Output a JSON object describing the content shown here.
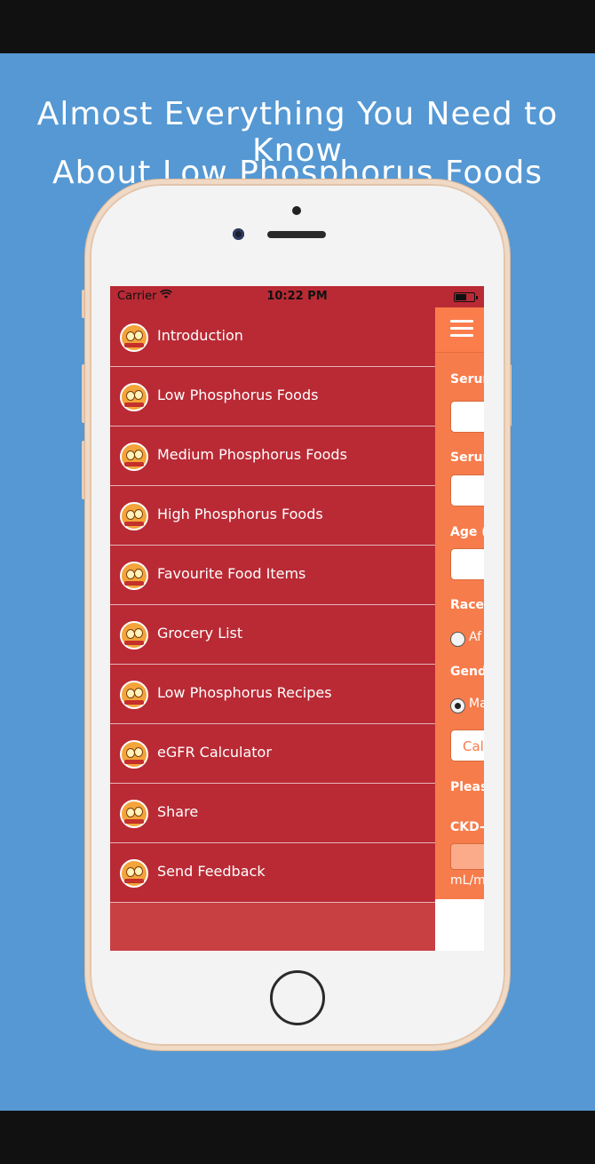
{
  "headline": {
    "line1": "Almost Everything You Need to Know",
    "line2": "About Low Phosphorus Foods"
  },
  "status_bar": {
    "carrier": "Carrier",
    "wifi_icon": "wifi-icon",
    "time": "10:22 PM",
    "battery_icon": "battery-icon"
  },
  "menu": {
    "items": [
      {
        "label": "Introduction",
        "icon": "app-logo-icon"
      },
      {
        "label": "Low Phosphorus Foods",
        "icon": "app-logo-icon"
      },
      {
        "label": "Medium Phosphorus Foods",
        "icon": "app-logo-icon"
      },
      {
        "label": "High Phosphorus Foods",
        "icon": "app-logo-icon"
      },
      {
        "label": "Favourite Food Items",
        "icon": "app-logo-icon"
      },
      {
        "label": "Grocery List",
        "icon": "app-logo-icon"
      },
      {
        "label": "Low Phosphorus Recipes",
        "icon": "app-logo-icon"
      },
      {
        "label": "eGFR Calculator",
        "icon": "app-logo-icon"
      },
      {
        "label": "Share",
        "icon": "app-logo-icon"
      },
      {
        "label": "Send Feedback",
        "icon": "app-logo-icon"
      }
    ]
  },
  "panel": {
    "menu_icon": "hamburger-menu-icon",
    "label_serum1": "Serur",
    "label_serum2": "Serur",
    "label_age": "Age (",
    "label_race": "Race",
    "race_option": "Af",
    "label_gender": "Gend",
    "gender_option": "Ma",
    "calculate_button": "Cal",
    "please_text": "Pleas",
    "ckd_label": "CKD-",
    "unit_text": "mL/m"
  },
  "colors": {
    "background": "#5598d3",
    "menu": "#b92a35",
    "panel": "#f77b4b"
  }
}
